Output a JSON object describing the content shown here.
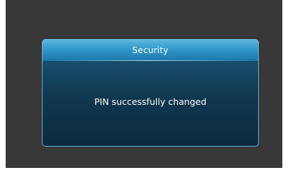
{
  "dialog": {
    "title": "Security",
    "message": "PIN successfully changed"
  },
  "colors": {
    "screen_background": "#383838",
    "header_blue": "#2f93c6",
    "body_navy": "#10374f",
    "text": "#ffffff"
  }
}
